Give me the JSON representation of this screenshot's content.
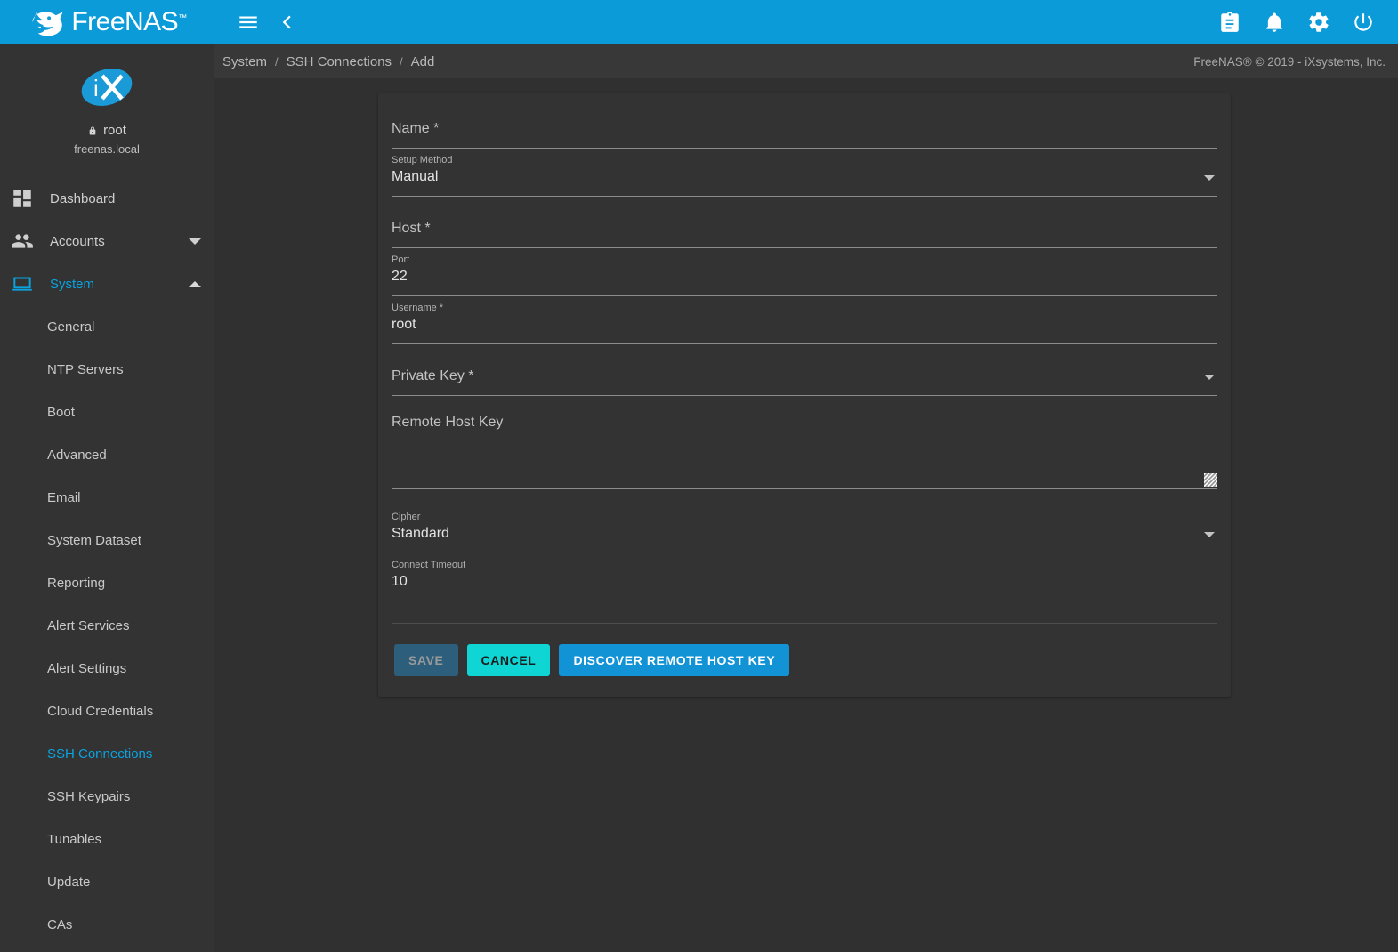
{
  "topbar": {
    "brand_name": "FreeNAS",
    "brand_tm": "™",
    "menu_icon": "hamburger-menu-icon",
    "back_icon": "chevron-left-icon",
    "right_icons": [
      "clipboard-tasks-icon",
      "notifications-bell-icon",
      "settings-gear-icon",
      "power-icon"
    ]
  },
  "sidebar": {
    "avatar_icon": "ix-systems-logo",
    "username": "root",
    "hostname": "freenas.local",
    "nav": [
      {
        "label": "Dashboard",
        "icon": "dashboard-grid-icon",
        "active": false,
        "expandable": false
      },
      {
        "label": "Accounts",
        "icon": "accounts-people-icon",
        "active": false,
        "expandable": true,
        "expanded": false
      },
      {
        "label": "System",
        "icon": "system-laptop-icon",
        "active": true,
        "expandable": true,
        "expanded": true
      }
    ],
    "system_children": [
      {
        "label": "General",
        "active": false
      },
      {
        "label": "NTP Servers",
        "active": false
      },
      {
        "label": "Boot",
        "active": false
      },
      {
        "label": "Advanced",
        "active": false
      },
      {
        "label": "Email",
        "active": false
      },
      {
        "label": "System Dataset",
        "active": false
      },
      {
        "label": "Reporting",
        "active": false
      },
      {
        "label": "Alert Services",
        "active": false
      },
      {
        "label": "Alert Settings",
        "active": false
      },
      {
        "label": "Cloud Credentials",
        "active": false
      },
      {
        "label": "SSH Connections",
        "active": true
      },
      {
        "label": "SSH Keypairs",
        "active": false
      },
      {
        "label": "Tunables",
        "active": false
      },
      {
        "label": "Update",
        "active": false
      },
      {
        "label": "CAs",
        "active": false
      }
    ]
  },
  "breadcrumb": {
    "item1": "System",
    "sep1": "/",
    "item2": "SSH Connections",
    "sep2": "/",
    "item3": "Add",
    "copyright": "FreeNAS® © 2019 - iXsystems, Inc."
  },
  "form": {
    "name": {
      "label": "Name *",
      "value": ""
    },
    "setup_method": {
      "label": "Setup Method",
      "value": "Manual"
    },
    "host": {
      "label": "Host *",
      "value": ""
    },
    "port": {
      "label": "Port",
      "value": "22"
    },
    "username": {
      "label": "Username *",
      "value": "root"
    },
    "private_key": {
      "label": "Private Key *",
      "value": ""
    },
    "remote_host_key": {
      "label": "Remote Host Key",
      "value": ""
    },
    "cipher": {
      "label": "Cipher",
      "value": "Standard"
    },
    "connect_timeout": {
      "label": "Connect Timeout",
      "value": "10"
    }
  },
  "actions": {
    "save": "SAVE",
    "cancel": "CANCEL",
    "discover": "DISCOVER REMOTE HOST KEY"
  },
  "colors": {
    "brand_blue": "#0b9bd9",
    "accent_blue": "#0aa3e0",
    "cancel_cyan": "#0fd5d5",
    "discover_blue": "#1193d6",
    "save_disabled": "#2d5f7d",
    "page_bg": "#303030",
    "panel_bg": "#333333"
  }
}
